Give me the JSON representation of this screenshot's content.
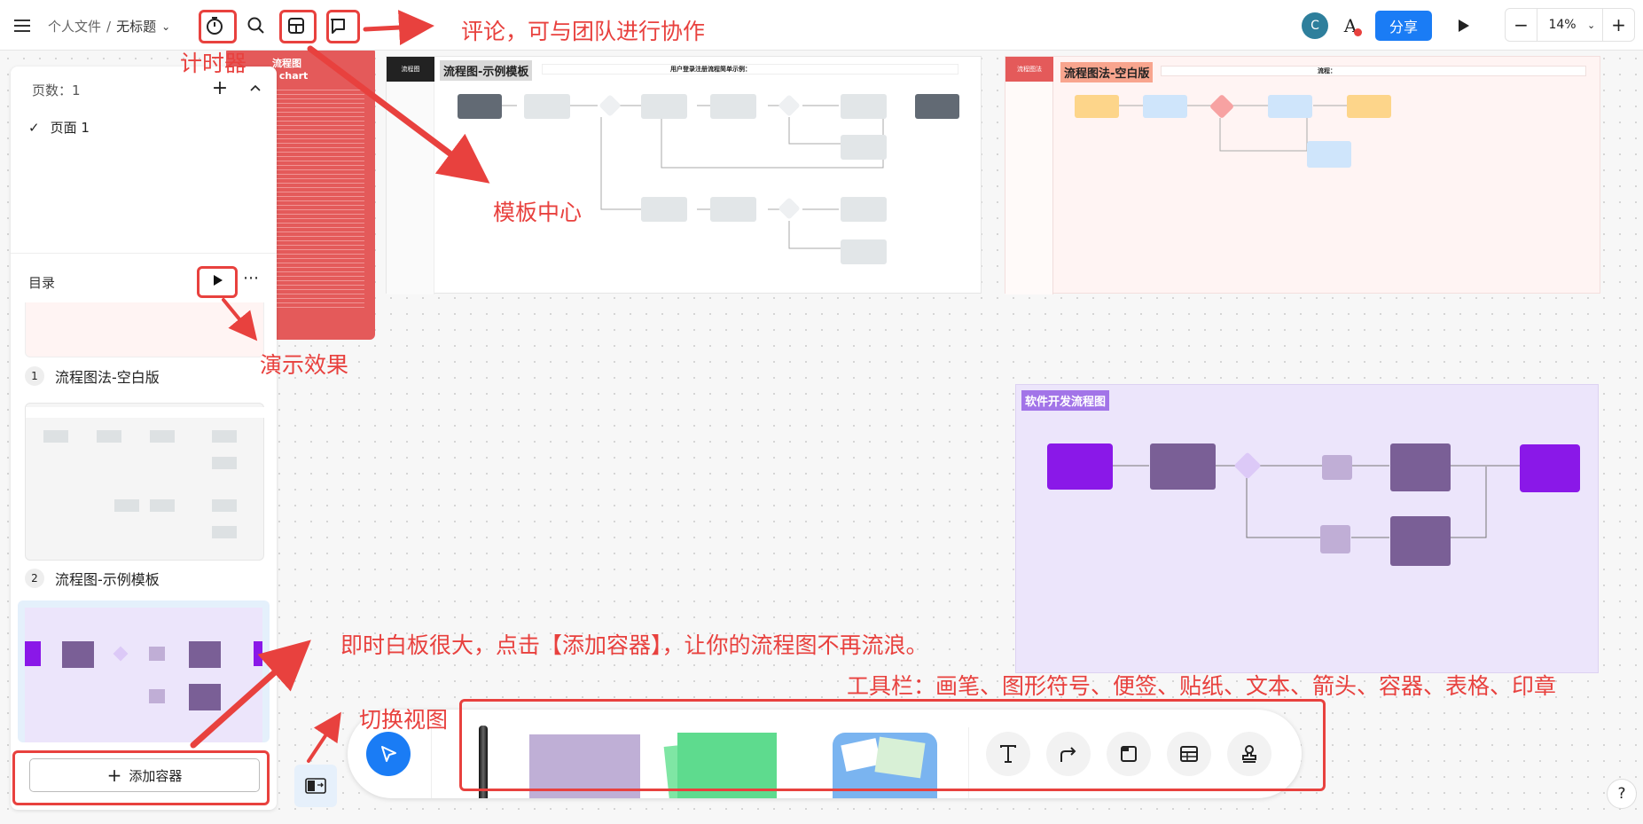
{
  "header": {
    "breadcrumb_root": "个人文件",
    "breadcrumb_sep": "/",
    "doc_title": "无标题",
    "avatar_letter": "C",
    "share_label": "分享",
    "zoom_level": "14%",
    "zoom_minus": "−",
    "zoom_plus": "+"
  },
  "pages_panel": {
    "page_count": "页数：1",
    "pages": [
      "页面 1"
    ]
  },
  "toc": {
    "title": "目录",
    "items": [
      {
        "index": "1",
        "label": "流程图法-空白版"
      },
      {
        "index": "2",
        "label": "流程图-示例模板"
      }
    ],
    "add_container_label": "添加容器"
  },
  "frames": {
    "example": {
      "badge": "流程图-示例模板",
      "header_title": "用户登录注册流程简单示例：",
      "side_label": "流程图",
      "red_panel_title": "流程图",
      "red_panel_subtitle": "/ chart"
    },
    "blank": {
      "badge": "流程图法-空白版",
      "side_label": "流程图法",
      "header_title": "流程："
    },
    "software": {
      "badge": "软件开发流程图"
    }
  },
  "annotations": {
    "timer": "计时器",
    "comment": "评论，可与团队进行协作",
    "template_center": "模板中心",
    "demo_effect": "演示效果",
    "add_container_tip": "即时白板很大，点击【添加容器】，让你的流程图不再流浪。",
    "toolbar_tip": "工具栏：画笔、图形符号、便签、贴纸、文本、箭头、容器、表格、印章",
    "switch_view": "切换视图"
  },
  "help_label": "?",
  "colors": {
    "accent_red": "#e8413e",
    "share_blue": "#1a7cf5",
    "purple": "#8a18e8",
    "purple_dark": "#7a5f96"
  }
}
